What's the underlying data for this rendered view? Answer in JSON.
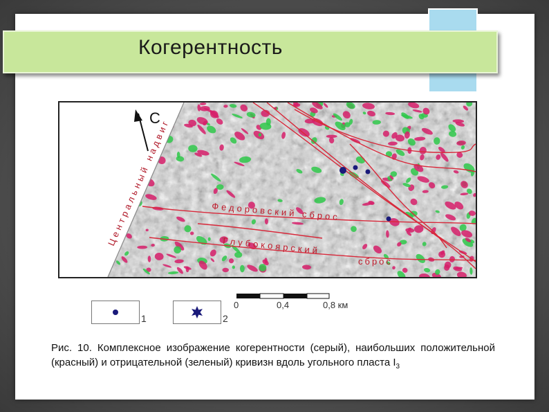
{
  "slide": {
    "title": "Когерентность"
  },
  "figure": {
    "north_label": "С",
    "fault_labels": {
      "central": "Центральный надвиг",
      "fedorovsky": "Федоровский сброс",
      "glubokoyarsky_part1": "Глубокоярский",
      "glubokoyarsky_part2": "сброс"
    },
    "legend": [
      {
        "number": "1",
        "symbol": "dot"
      },
      {
        "number": "2",
        "symbol": "star"
      }
    ],
    "scale": {
      "labels": [
        "0",
        "0,4",
        "0,8 км"
      ]
    },
    "colors": {
      "positive_curvature": "#d61f6a",
      "negative_curvature": "#2fc84a",
      "fault_line": "#d8283a",
      "marker": "#1a1a7a"
    }
  },
  "caption": {
    "text": "Рис. 10. Комплексное изображение когерентности (серый), наибольших положительной (красный) и отрицательной (зеленый) кривизн вдоль угольного пласта I",
    "subscript": "3"
  }
}
